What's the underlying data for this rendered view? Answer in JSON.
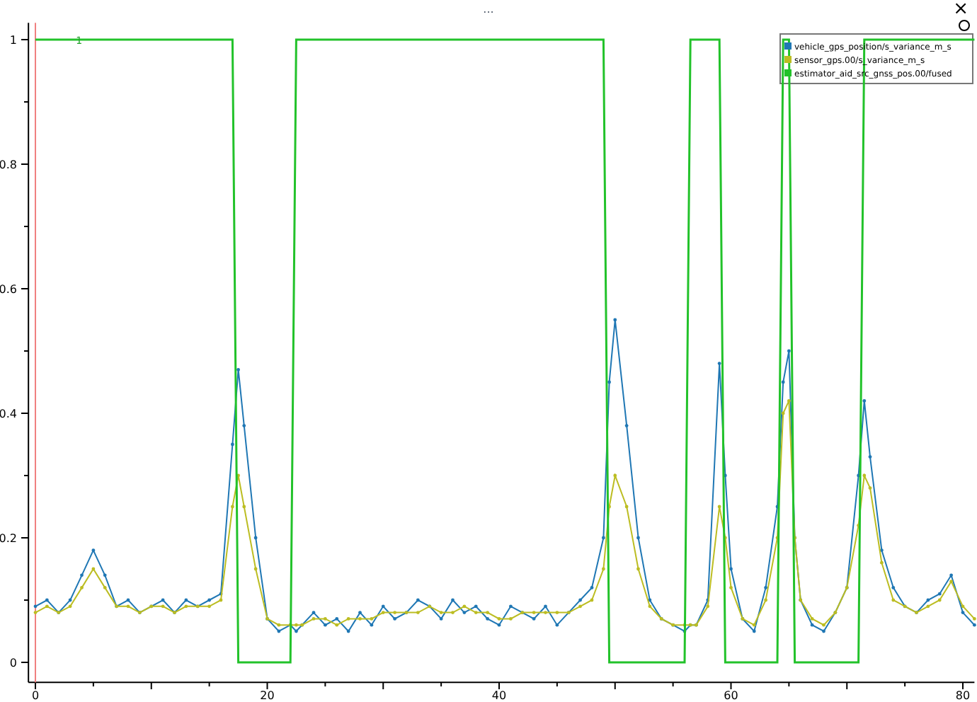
{
  "window": {
    "title": "...",
    "close": "×"
  },
  "plot": {
    "chart_data": {
      "type": "line",
      "x": [
        0,
        1,
        2,
        3,
        4,
        5,
        6,
        7,
        8,
        9,
        10,
        11,
        12,
        13,
        14,
        15,
        16,
        17,
        17.5,
        18,
        19,
        20,
        21,
        22,
        22.5,
        23,
        24,
        25,
        26,
        27,
        28,
        29,
        30,
        31,
        32,
        33,
        34,
        35,
        36,
        37,
        38,
        39,
        40,
        41,
        42,
        43,
        44,
        45,
        46,
        47,
        48,
        49,
        49.5,
        50,
        51,
        52,
        53,
        54,
        55,
        56,
        56.5,
        57,
        58,
        59,
        59.5,
        60,
        61,
        62,
        63,
        64,
        64.5,
        65,
        65.5,
        66,
        67,
        68,
        69,
        70,
        71,
        71.5,
        72,
        73,
        74,
        75,
        76,
        77,
        78,
        79,
        80,
        81
      ],
      "series": [
        {
          "name": "vehicle_gps_position/s_variance_m_s",
          "color": "#1f77b4",
          "values": [
            0.09,
            0.1,
            0.08,
            0.1,
            0.14,
            0.18,
            0.14,
            0.09,
            0.1,
            0.08,
            0.09,
            0.1,
            0.08,
            0.1,
            0.09,
            0.1,
            0.11,
            0.35,
            0.47,
            0.38,
            0.2,
            0.07,
            0.05,
            0.06,
            0.05,
            0.06,
            0.08,
            0.06,
            0.07,
            0.05,
            0.08,
            0.06,
            0.09,
            0.07,
            0.08,
            0.1,
            0.09,
            0.07,
            0.1,
            0.08,
            0.09,
            0.07,
            0.06,
            0.09,
            0.08,
            0.07,
            0.09,
            0.06,
            0.08,
            0.1,
            0.12,
            0.2,
            0.45,
            0.55,
            0.38,
            0.2,
            0.1,
            0.07,
            0.06,
            0.05,
            0.06,
            0.06,
            0.1,
            0.48,
            0.3,
            0.15,
            0.07,
            0.05,
            0.12,
            0.25,
            0.45,
            0.5,
            0.2,
            0.1,
            0.06,
            0.05,
            0.08,
            0.12,
            0.3,
            0.42,
            0.33,
            0.18,
            0.12,
            0.09,
            0.08,
            0.1,
            0.11,
            0.14,
            0.08,
            0.06
          ]
        },
        {
          "name": "sensor_gps.00/s_variance_m_s",
          "color": "#bcbd22",
          "values": [
            0.08,
            0.09,
            0.08,
            0.09,
            0.12,
            0.15,
            0.12,
            0.09,
            0.09,
            0.08,
            0.09,
            0.09,
            0.08,
            0.09,
            0.09,
            0.09,
            0.1,
            0.25,
            0.3,
            0.25,
            0.15,
            0.07,
            0.06,
            0.06,
            0.06,
            0.06,
            0.07,
            0.07,
            0.06,
            0.07,
            0.07,
            0.07,
            0.08,
            0.08,
            0.08,
            0.08,
            0.09,
            0.08,
            0.08,
            0.09,
            0.08,
            0.08,
            0.07,
            0.07,
            0.08,
            0.08,
            0.08,
            0.08,
            0.08,
            0.09,
            0.1,
            0.15,
            0.25,
            0.3,
            0.25,
            0.15,
            0.09,
            0.07,
            0.06,
            0.06,
            0.06,
            0.06,
            0.09,
            0.25,
            0.2,
            0.12,
            0.07,
            0.06,
            0.1,
            0.2,
            0.4,
            0.42,
            0.2,
            0.1,
            0.07,
            0.06,
            0.08,
            0.12,
            0.22,
            0.3,
            0.28,
            0.16,
            0.1,
            0.09,
            0.08,
            0.09,
            0.1,
            0.13,
            0.09,
            0.07
          ]
        },
        {
          "name": "estimator_aid_src_gnss_pos.00/fused",
          "color": "#22c22a",
          "values": [
            1,
            1,
            1,
            1,
            1,
            1,
            1,
            1,
            1,
            1,
            1,
            1,
            1,
            1,
            1,
            1,
            1,
            1,
            0,
            0,
            0,
            0,
            0,
            0,
            1,
            1,
            1,
            1,
            1,
            1,
            1,
            1,
            1,
            1,
            1,
            1,
            1,
            1,
            1,
            1,
            1,
            1,
            1,
            1,
            1,
            1,
            1,
            1,
            1,
            1,
            1,
            1,
            0,
            0,
            0,
            0,
            0,
            0,
            0,
            0,
            1,
            1,
            1,
            1,
            0,
            0,
            0,
            0,
            0,
            0,
            1,
            1,
            0,
            0,
            0,
            0,
            0,
            0,
            0,
            1,
            1,
            1,
            1,
            1,
            1,
            1,
            1,
            1,
            1,
            1
          ]
        }
      ],
      "xlim": [
        -0.6,
        81
      ],
      "ylim": [
        -0.032,
        1.027
      ],
      "legend": "upper right",
      "ref_lines": [
        {
          "axis": "x",
          "value": 0,
          "color": "#f08080"
        }
      ],
      "xticks": [
        0,
        20,
        40,
        60,
        80
      ],
      "yticks": [
        0,
        {
          "value": 0.2,
          "label": "0.2"
        },
        {
          "value": 0.4,
          "label": "0.4"
        },
        {
          "value": 0.6,
          "label": "0.6"
        },
        {
          "value": 0.8,
          "label": "0.8"
        },
        1
      ],
      "annotations": [
        {
          "x": 2,
          "y": 1,
          "text": "1"
        }
      ]
    }
  }
}
